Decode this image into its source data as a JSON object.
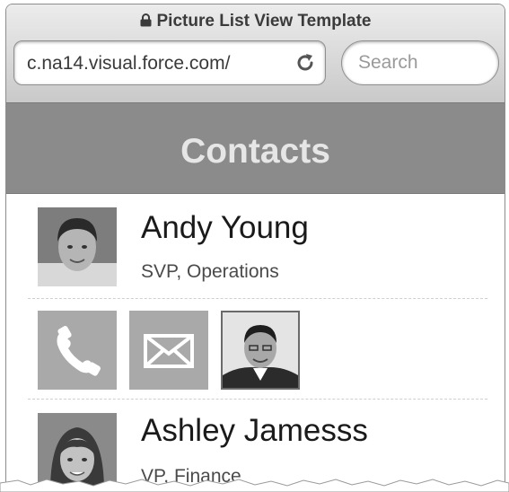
{
  "window": {
    "title": "Picture List View Template"
  },
  "browser": {
    "url": "c.na14.visual.force.com/",
    "search_placeholder": "Search"
  },
  "header": {
    "title": "Contacts"
  },
  "contacts": [
    {
      "name": "Andy Young",
      "title": "SVP, Operations"
    },
    {
      "name": "Ashley Jamesss",
      "title": "VP, Finance"
    }
  ],
  "actions": [
    {
      "icon": "phone-icon"
    },
    {
      "icon": "email-icon"
    },
    {
      "icon": "contact-photo"
    }
  ],
  "colors": {
    "header_bar": "#8b8b8b",
    "header_text": "#e6e6e6",
    "action_button": "#a9a9a9"
  }
}
